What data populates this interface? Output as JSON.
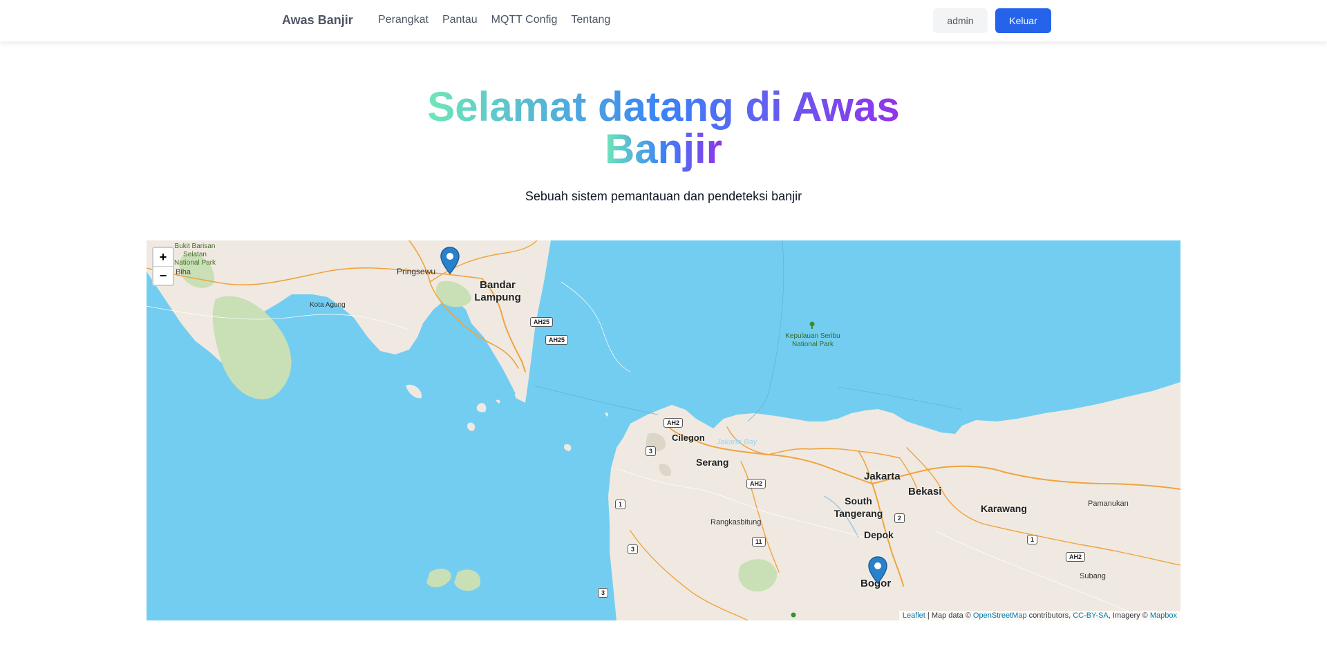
{
  "nav": {
    "brand": "Awas Banjir",
    "links": [
      "Perangkat",
      "Pantau",
      "MQTT Config",
      "Tentang"
    ],
    "user_label": "admin",
    "logout_label": "Keluar"
  },
  "hero": {
    "title_line1": "Selamat datang di Awas",
    "title_line2": "Banjir",
    "subtitle": "Sebuah sistem pemantauan dan pendeteksi banjir"
  },
  "map": {
    "zoom_in": "+",
    "zoom_out": "−",
    "place_labels": {
      "bukit_barisan": "Bukit Barisan Selatan",
      "national_park": "National Park",
      "biha": "Biha",
      "pringsewu": "Pringsewu",
      "bandar": "Bandar",
      "lampung": "Lampung",
      "kota_agung": "Kota Agung",
      "kepulauan_seribu": "Kepulauan Seribu",
      "kepulauan_np": "National Park",
      "cilegon": "Cilegon",
      "serang": "Serang",
      "jakarta": "Jakarta",
      "bekasi": "Bekasi",
      "south": "South",
      "tangerang": "Tangerang",
      "karawang": "Karawang",
      "pamanukan": "Pamanukan",
      "depok": "Depok",
      "rangkasbitung": "Rangkasbitung",
      "bogor": "Bogor",
      "subang": "Subang",
      "jakarta_bay": "Jakarta Bay"
    },
    "road_shields": {
      "r1a": "1",
      "ah25a": "AH25",
      "ah25b": "AH25",
      "ah2a": "AH2",
      "r3a": "3",
      "ah2b": "AH2",
      "r2": "2",
      "r1b": "1",
      "r11": "11",
      "r3b": "3",
      "ah2c": "AH2",
      "r3c": "3"
    },
    "attribution": {
      "leaflet": "Leaflet",
      "map_data": " | Map data © ",
      "osm": "OpenStreetMap",
      "contributors": " contributors, ",
      "license": "CC-BY-SA",
      "imagery": ", Imagery © ",
      "mapbox": "Mapbox"
    },
    "colors": {
      "water": "#73cdf0",
      "land": "#efe9e1",
      "park": "#c9dfb6",
      "road": "#f0a33e",
      "marker": "#2a81cb"
    }
  }
}
